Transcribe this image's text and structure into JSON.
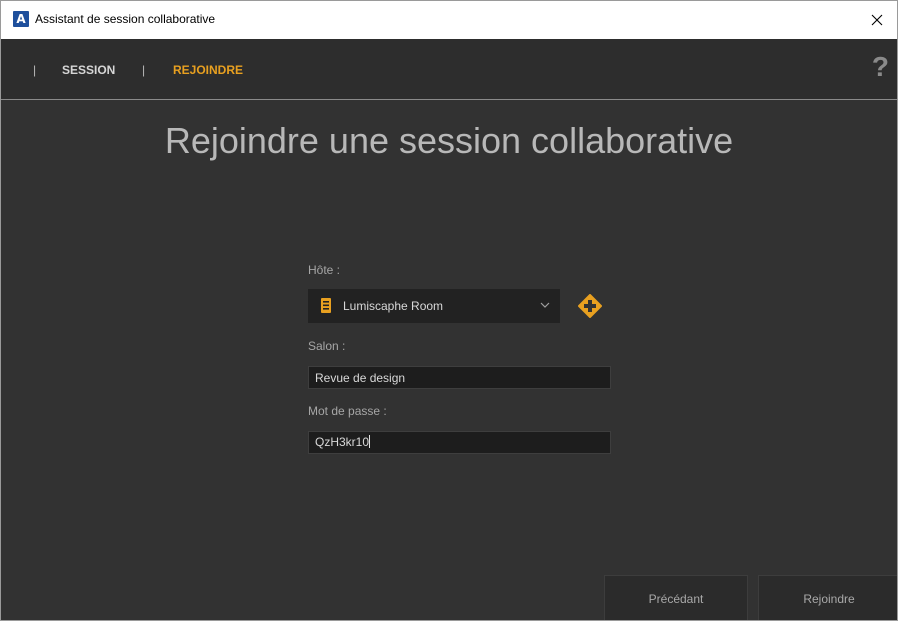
{
  "window": {
    "title": "Assistant de session collaborative",
    "app_icon_letter": "A",
    "close_glyph": "×"
  },
  "nav": {
    "separator": "|",
    "tabs": [
      {
        "label": "SESSION",
        "active": false
      },
      {
        "label": "REJOINDRE",
        "active": true
      }
    ],
    "help_glyph": "?"
  },
  "main": {
    "heading": "Rejoindre une session collaborative",
    "host": {
      "label": "Hôte :",
      "selected": "Lumiscaphe Room",
      "icon": "server-icon",
      "add_icon": "add-circle-icon"
    },
    "room": {
      "label": "Salon :",
      "value": "Revue de design"
    },
    "password": {
      "label": "Mot de passe :",
      "value": "QzH3kr10"
    }
  },
  "footer": {
    "previous_label": "Précédant",
    "join_label": "Rejoindre"
  },
  "colors": {
    "accent": "#e8a020",
    "background": "#323232",
    "nav_background": "#2d2d2d",
    "input_background": "#1d1d1d"
  }
}
